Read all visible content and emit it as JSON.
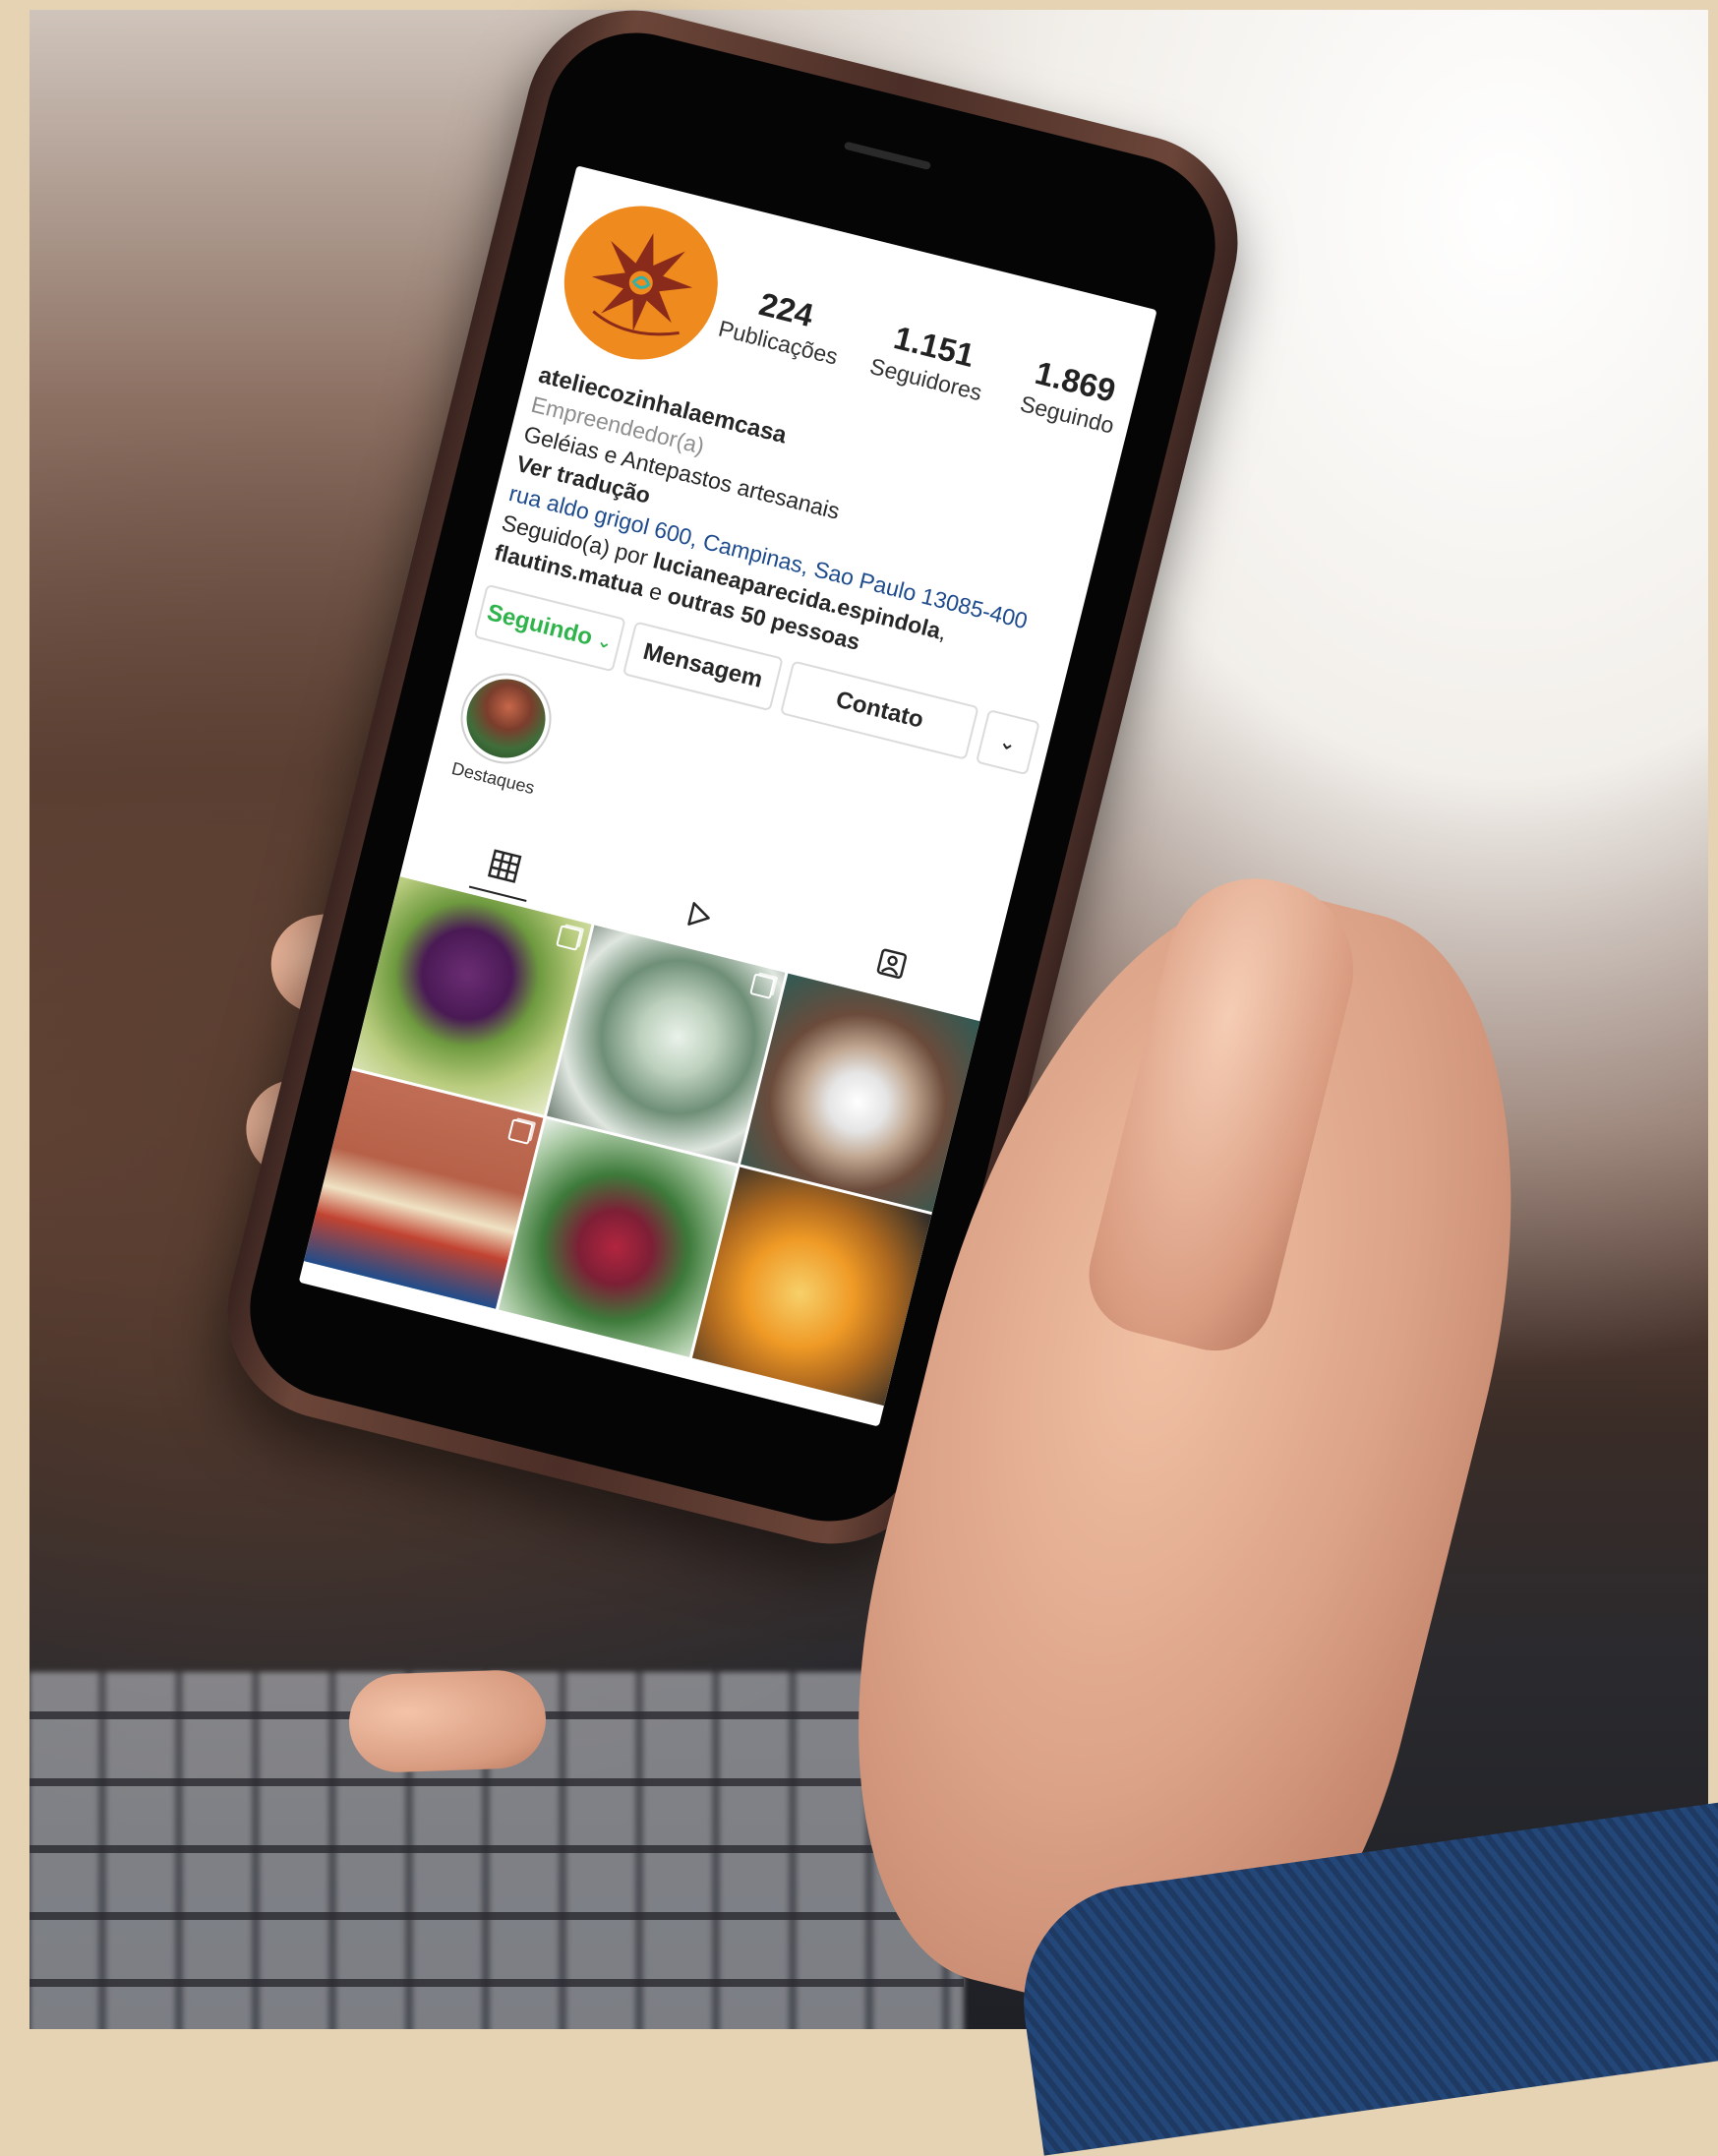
{
  "profile": {
    "username": "ateliecozinhalaemcasa",
    "category": "Empreendedor(a)",
    "bio": "Geléias e Antepastos artesanais",
    "translate_label": "Ver tradução",
    "address": "rua aldo grigol 600, Campinas, Sao Paulo 13085-400",
    "followed_prefix": "Seguido(a) por",
    "followed_user1": "lucianeaparecida.espindola",
    "followed_comma": ",",
    "followed_user2": "flautins.matua",
    "followed_and": "e",
    "followed_others": "outras 50 pessoas"
  },
  "stats": [
    {
      "value": "224",
      "label": "Publicações"
    },
    {
      "value": "1.151",
      "label": "Seguidores"
    },
    {
      "value": "1.869",
      "label": "Seguindo"
    }
  ],
  "actions": {
    "following_label": "Seguindo",
    "following_chevron": "⌄",
    "message_label": "Mensagem",
    "contact_label": "Contato",
    "more_icon": "⌄"
  },
  "highlights": [
    {
      "label": "Destaques"
    }
  ],
  "tabs": [
    {
      "icon": "grid-icon",
      "active": true
    },
    {
      "icon": "reels-icon",
      "active": false
    },
    {
      "icon": "tagged-icon",
      "active": false
    }
  ],
  "colors": {
    "avatar_bg": "#ef8a1e",
    "following_green": "#2fb34b",
    "link_blue": "#1c4a8c"
  }
}
